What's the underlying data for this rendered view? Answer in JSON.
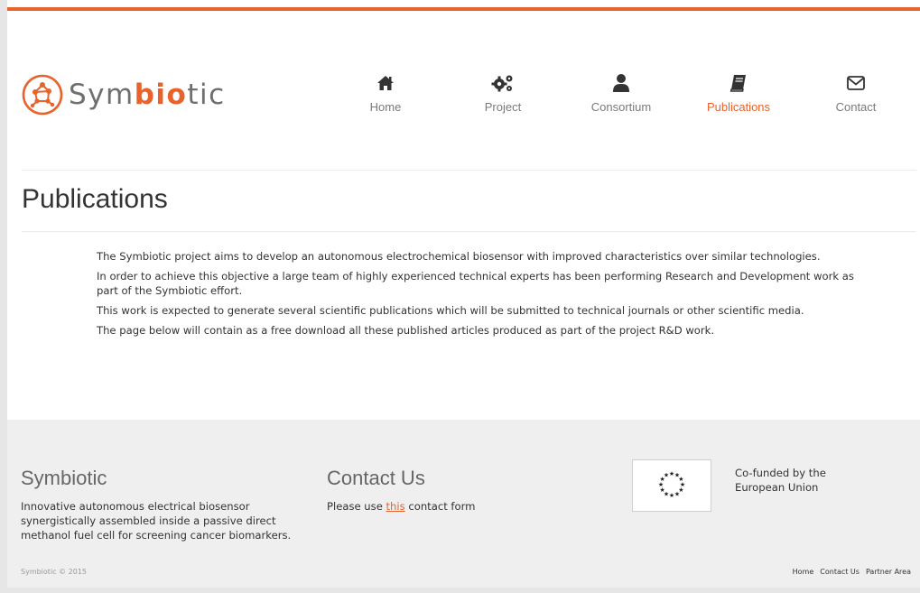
{
  "brand": {
    "name_prefix": "Sym",
    "name_accent": "bio",
    "name_suffix": "tic",
    "accent_color": "#e8632b",
    "logo_icon": "molecule-logo-icon"
  },
  "nav": [
    {
      "label": "Home",
      "icon": "home-icon",
      "active": false
    },
    {
      "label": "Project",
      "icon": "gears-icon",
      "active": false
    },
    {
      "label": "Consortium",
      "icon": "user-icon",
      "active": false
    },
    {
      "label": "Publications",
      "icon": "book-icon",
      "active": true
    },
    {
      "label": "Contact",
      "icon": "envelope-icon",
      "active": false
    }
  ],
  "page": {
    "title": "Publications",
    "paragraphs": [
      "The Symbiotic project aims to develop an autonomous electrochemical biosensor with improved characteristics over similar technologies.",
      "In order to achieve this objective a large team of highly experienced technical experts has been performing Research and Development work as part of the Symbiotic effort.",
      "This work is expected to generate several scientific publications which will be submitted to technical journals or other scientific media.",
      "The page below will contain as a free download all these published articles produced as part of the project R&D work."
    ]
  },
  "footer": {
    "about_title": "Symbiotic",
    "about_text": "Innovative autonomous electrical biosensor synergistically assembled inside a passive direct methanol fuel cell for screening cancer biomarkers.",
    "contact_title": "Contact Us",
    "contact_prefix": "Please use ",
    "contact_link": "this",
    "contact_suffix": " contact form",
    "eu_flag_icon": "eu-flag-icon",
    "eu_text": "Co-funded by the European Union",
    "copyright": "Symbiotic © 2015",
    "links": [
      "Home",
      "Contact Us",
      "Partner Area"
    ]
  }
}
